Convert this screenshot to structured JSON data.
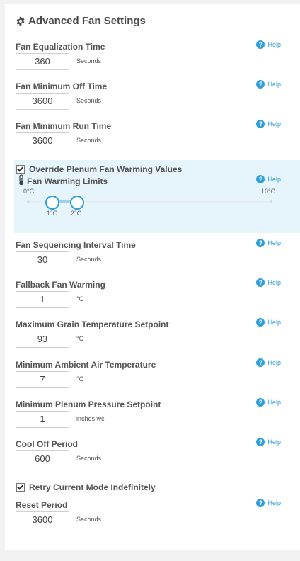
{
  "title": "Advanced Fan Settings",
  "help_label": "Help",
  "fields": [
    {
      "label": "Fan Equalization Time",
      "value": "360",
      "unit": "Seconds"
    },
    {
      "label": "Fan Minimum Off Time",
      "value": "3600",
      "unit": "Seconds"
    },
    {
      "label": "Fan Minimum Run Time",
      "value": "3600",
      "unit": "Seconds"
    },
    {
      "label": "Fan Sequencing Interval Time",
      "value": "30",
      "unit": "Seconds"
    },
    {
      "label": "Fallback Fan Warming",
      "value": "1",
      "unit": "°C"
    },
    {
      "label": "Maximum Grain Temperature Setpoint",
      "value": "93",
      "unit": "°C"
    },
    {
      "label": "Minimum Ambient Air Temperature",
      "value": "7",
      "unit": "°C"
    },
    {
      "label": "Minimum Plenum Pressure Setpoint",
      "value": "1",
      "unit": "inches wc"
    },
    {
      "label": "Cool Off Period",
      "value": "600",
      "unit": "Seconds"
    },
    {
      "label": "Reset Period",
      "value": "3600",
      "unit": "Seconds"
    }
  ],
  "override": {
    "checkbox_label": "Override Plenum Fan Warming Values",
    "checked": true,
    "limits_label": "Fan Warming Limits",
    "min_label": "0°C",
    "max_label": "10°C",
    "low_value": "1°C",
    "high_value": "2°C"
  },
  "retry": {
    "checkbox_label": "Retry Current Mode Indefinitely",
    "checked": true
  },
  "colors": {
    "accent": "#2e9fdb",
    "highlight_bg": "#e6f4fc"
  }
}
